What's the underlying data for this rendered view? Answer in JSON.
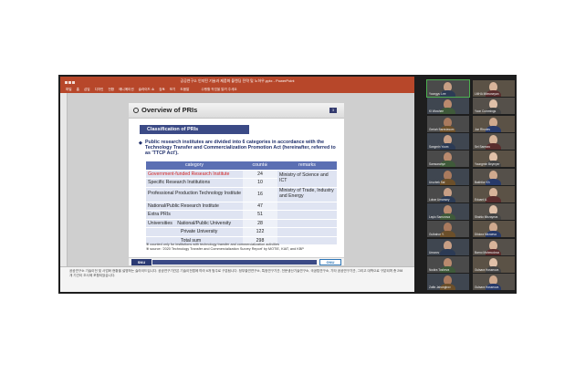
{
  "window": {
    "title": "공공연구소 인지된 기술과 제품화 블렌딩 전략 및 노하우.pptx - PowerPoint",
    "menu": [
      "파일",
      "홈",
      "삽입",
      "디자인",
      "전환",
      "애니메이션",
      "슬라이드 쇼",
      "검토",
      "보기",
      "도움말"
    ],
    "tell_me": "수행할 작업을 알려 주세요"
  },
  "slide": {
    "title": "Overview of PRIs",
    "page_num": "3",
    "section": "Classification of PRIs",
    "bullet": "Public research institutes are divided into 6 categories in accordance with the Technology Transfer and Commercialization Promotion Act (hereinafter, referred to as 'TTCP Act').",
    "table": {
      "headers": [
        "category",
        "count※",
        "remarks"
      ],
      "rows": [
        {
          "category": "Government-funded Research Institute",
          "count": "24"
        },
        {
          "category": "Specific Research Institutions",
          "count": "10"
        },
        {
          "category": "Professional Production Technology Institute",
          "count": "16"
        },
        {
          "category": "National/Public Research Institute",
          "count": "47"
        },
        {
          "category": "Extra PRIs",
          "count": "51"
        }
      ],
      "remark_1": "Ministry of Science and ICT",
      "remark_2": "Ministry of Trade, Industry and Energy",
      "universities_label": "Universities",
      "univ_rows": [
        {
          "category": "National/Public University",
          "count": "28"
        },
        {
          "category": "Private University",
          "count": "122"
        }
      ],
      "total_label": "Total sum",
      "total": "298"
    },
    "notes": [
      "※ counted only for institutions with technology transfer and commercialization activities",
      "※ source: '2020 Technology Transfer and Commercialization Survey Report' by MOTIE, KIAT, and KBP"
    ],
    "logo_left": "SNU",
    "logo_right": "GNU"
  },
  "speaker_notes": "공공연구소 기술이전 및 사업화 현황을 설명하는 슬라이드입니다. 공공연구기관은 기술이전법에 따라 6개 범주로 구분됩니다. 정부출연연구소, 특정연구기관, 전문생산기술연구소, 국공립연구소, 기타 공공연구기관, 그리고 대학으로 구분되며 총 298개 기관이 조사에 포함되었습니다.",
  "participants": [
    {
      "name": "Yoongyu Lee"
    },
    {
      "name": "LMHA Milmoseyan"
    },
    {
      "name": "Ki Wowhee"
    },
    {
      "name": "Yoon Cummings"
    },
    {
      "name": "Gertah Baraviasum"
    },
    {
      "name": "Jun Rhodes"
    },
    {
      "name": "Sangmin Yoom"
    },
    {
      "name": "Sei Samseo"
    },
    {
      "name": "Samsarahye"
    },
    {
      "name": "Youngmin Beymyer"
    },
    {
      "name": "Urozbek Sal"
    },
    {
      "name": "Bakhtior Kh"
    },
    {
      "name": "Lobar Umansey"
    },
    {
      "name": "Eduard A."
    },
    {
      "name": "Laylo Samurova"
    },
    {
      "name": "Shahlo Mirzayeva"
    },
    {
      "name": "Gulbahor Y."
    },
    {
      "name": "Dildora Mirzaeva"
    },
    {
      "name": "Umarov"
    },
    {
      "name": "Barno Mahmudova"
    },
    {
      "name": "Nodira Tosheva"
    },
    {
      "name": "Gulsara Hosseova"
    },
    {
      "name": "Zaffa Jahongirov"
    },
    {
      "name": "Gulsara Hosseova"
    }
  ],
  "colors": {
    "ppt_accent": "#b7472a",
    "table_header": "#5b6fb3",
    "ribbon": "#3b4a86"
  }
}
